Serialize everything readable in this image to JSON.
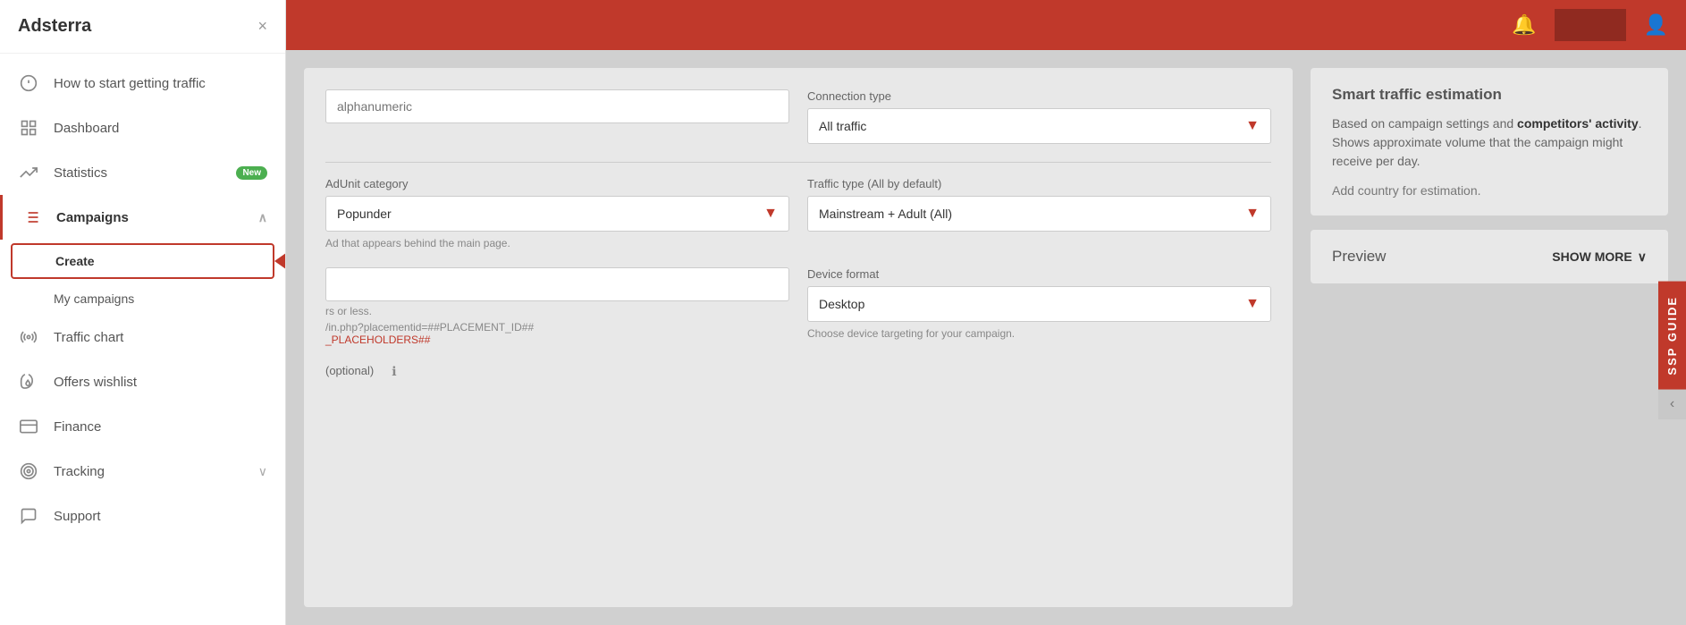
{
  "sidebar": {
    "logo": "Adsterra",
    "close_label": "×",
    "items": [
      {
        "id": "how-to-start",
        "label": "How to start getting traffic",
        "icon": "alert-circle"
      },
      {
        "id": "dashboard",
        "label": "Dashboard",
        "icon": "grid"
      },
      {
        "id": "statistics",
        "label": "Statistics",
        "icon": "trending-up",
        "badge": "New"
      },
      {
        "id": "campaigns",
        "label": "Campaigns",
        "icon": "list",
        "has_chevron": true,
        "chevron_dir": "up",
        "active": true
      },
      {
        "id": "create",
        "label": "Create",
        "is_sub": true,
        "highlight": true
      },
      {
        "id": "my-campaigns",
        "label": "My campaigns",
        "is_sub": true
      },
      {
        "id": "traffic-chart",
        "label": "Traffic chart",
        "icon": "radio"
      },
      {
        "id": "offers-wishlist",
        "label": "Offers wishlist",
        "icon": "flame"
      },
      {
        "id": "finance",
        "label": "Finance",
        "icon": "credit-card"
      },
      {
        "id": "tracking",
        "label": "Tracking",
        "icon": "target",
        "has_chevron": true,
        "chevron_dir": "down"
      },
      {
        "id": "support",
        "label": "Support",
        "icon": "message-circle"
      }
    ]
  },
  "topbar": {
    "notification_icon": "🔔",
    "button_label": "",
    "user_icon": "👤"
  },
  "form": {
    "connection_type_label": "Connection type",
    "connection_type_value": "All traffic",
    "alphanumeric_placeholder": "alphanumeric",
    "adunit_category_label": "AdUnit category",
    "adunit_category_value": "Popunder",
    "adunit_hint": "Ad that appears behind the main page.",
    "traffic_type_label": "Traffic type (All by default)",
    "traffic_type_value": "Mainstream + Adult (All)",
    "device_format_label": "Device format",
    "device_format_value": "Desktop",
    "device_hint": "Choose device targeting for your campaign.",
    "url_hint": "rs or less.",
    "url_line1": "/in.php?placementid=##PLACEMENT_ID##",
    "url_placeholders": "_PLACEHOLDERS##",
    "optional_label": "(optional)",
    "info_icon": "ℹ"
  },
  "smart_estimation": {
    "title": "Smart traffic estimation",
    "text_before": "Based on campaign settings and ",
    "text_bold": "competitors' activity",
    "text_after": ". Shows approximate volume that the campaign might receive per day.",
    "note": "Add country for estimation."
  },
  "preview": {
    "title": "Preview",
    "show_more_label": "SHOW MORE",
    "chevron": "∨"
  },
  "ssp_guide": {
    "label": "SSP GUIDE",
    "chevron": "‹"
  }
}
